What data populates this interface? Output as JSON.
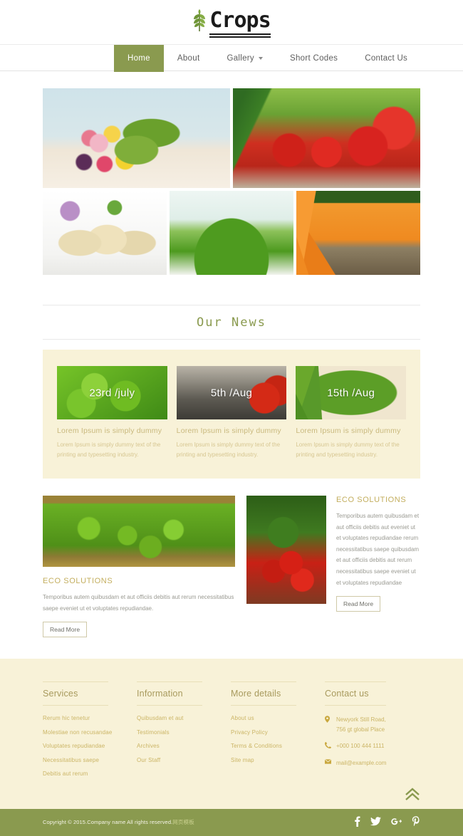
{
  "site": {
    "logo_text": "Crops",
    "logo_icon": "wheat-leaf-icon"
  },
  "nav": {
    "items": [
      {
        "label": "Home",
        "active": true
      },
      {
        "label": "About",
        "active": false
      },
      {
        "label": "Gallery",
        "active": false,
        "caret": true
      },
      {
        "label": "Short Codes",
        "active": false
      },
      {
        "label": "Contact Us",
        "active": false
      }
    ]
  },
  "gallery": {
    "tiles": [
      {
        "alt": "vegetables-on-table"
      },
      {
        "alt": "tomatoes-and-cucumber-on-plate"
      },
      {
        "alt": "potatoes"
      },
      {
        "alt": "greenhouse-lettuce"
      },
      {
        "alt": "carrots-in-basket"
      }
    ]
  },
  "news_section": {
    "title": "Our News",
    "cards": [
      {
        "date": "23rd /july",
        "title": "Lorem Ipsum is simply dummy",
        "desc": "Lorem Ipsum is simply dummy text of the printing and typesetting industry.",
        "image": "lettuce-leaves"
      },
      {
        "date": "5th /Aug",
        "title": "Lorem Ipsum is simply dummy",
        "desc": "Lorem Ipsum is simply dummy text of the printing and typesetting industry.",
        "image": "red-chilli-peppers"
      },
      {
        "date": "15th /Aug",
        "title": "Lorem Ipsum is simply dummy",
        "desc": "Lorem Ipsum is simply dummy text of the printing and typesetting industry.",
        "image": "green-beans-in-bowl"
      }
    ]
  },
  "eco_left": {
    "heading": "ECO SOLUTIONS",
    "body": "Temporibus autem quibusdam et aut officiis debitis aut rerum necessitatibus saepe eveniet ut et voluptates repudiandae.",
    "button": "Read More",
    "image": "green-peas-field"
  },
  "eco_right": {
    "heading": "ECO SOLUTIONS",
    "body": "Temporibus autem quibusdam et aut officiis debitis aut eveniet ut et voluptates repudiandae rerum necessitatibus saepe quibusdam et aut officiis debitis aut rerum necessitatibus saepe eveniet ut et voluptates repudiandae",
    "button": "Read More",
    "image": "tomatoes-on-vine"
  },
  "footer": {
    "services": {
      "heading": "Services",
      "items": [
        "Rerum hic tenetur",
        "Molestiae non recusandae",
        "Voluptates repudiandae",
        "Necessitatibus saepe",
        "Debitis aut rerum"
      ]
    },
    "information": {
      "heading": "Information",
      "items": [
        "Quibusdam et aut",
        "Testimonials",
        "Archives",
        "Our Staff"
      ]
    },
    "more_details": {
      "heading": "More details",
      "items": [
        "About us",
        "Privacy Policy",
        "Terms & Conditions",
        "Site map"
      ]
    },
    "contact": {
      "heading": "Contact us",
      "address_line1": "Newyork Still Road,",
      "address_line2": "756 gt global Place",
      "phone": "+000 100 444 1111",
      "email": "mail@example.com",
      "location_icon": "map-pin-icon",
      "phone_icon": "phone-icon",
      "mail_icon": "envelope-icon"
    },
    "to_top_icon": "double-chevron-up-icon"
  },
  "bottombar": {
    "copyright": "Copyright © 2015.Company name All rights reserved.",
    "copyright_cn": "网页模板",
    "socials": [
      {
        "name": "facebook",
        "glyph": "f"
      },
      {
        "name": "twitter",
        "glyph": "🐦"
      },
      {
        "name": "google-plus",
        "glyph": "g⁺"
      },
      {
        "name": "pinterest",
        "glyph": "𝑷"
      }
    ]
  },
  "colors": {
    "olive": "#8a9a4f",
    "cream": "#f8f2d8",
    "gold": "#c3ae5e",
    "muted": "#9a9a92"
  }
}
